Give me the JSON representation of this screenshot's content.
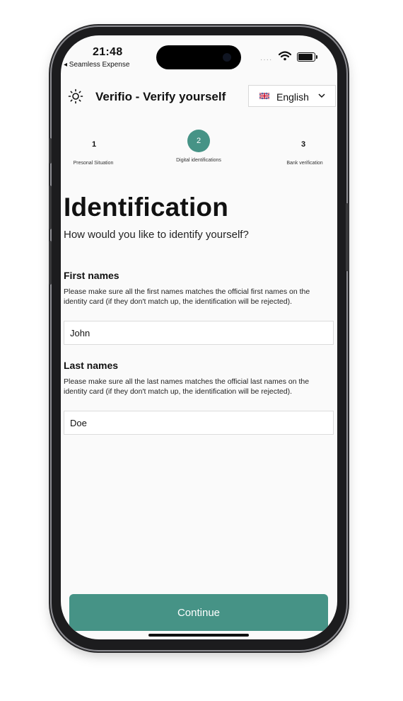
{
  "status_bar": {
    "time": "21:48",
    "back_label": "◂ Seamless Expense",
    "signal": "····"
  },
  "header": {
    "title": "Verifio - Verify yourself",
    "language": "English",
    "icon": "sun-icon",
    "flag_icon": "uk-flag-icon"
  },
  "stepper": {
    "active": 2,
    "steps": [
      {
        "number": "1",
        "label": "Presonal Situation"
      },
      {
        "number": "2",
        "label": "Digital identifications"
      },
      {
        "number": "3",
        "label": "Bank verification"
      }
    ]
  },
  "main": {
    "title": "Identification",
    "subtitle": "How would you like to identify yourself?"
  },
  "form": {
    "first_names": {
      "label": "First names",
      "help": "Please make sure all the first names matches the official first names on the identity card (if they don't match up, the identification will be rejected).",
      "value": "John"
    },
    "last_names": {
      "label": "Last names",
      "help": "Please make sure all the last names matches the official last names on the identity card (if they don't match up, the identification will be rejected).",
      "value": "Doe"
    }
  },
  "footer": {
    "continue_label": "Continue"
  },
  "colors": {
    "accent": "#469386",
    "screen_bg": "#fafafa",
    "frame": "#1c1c1e"
  }
}
